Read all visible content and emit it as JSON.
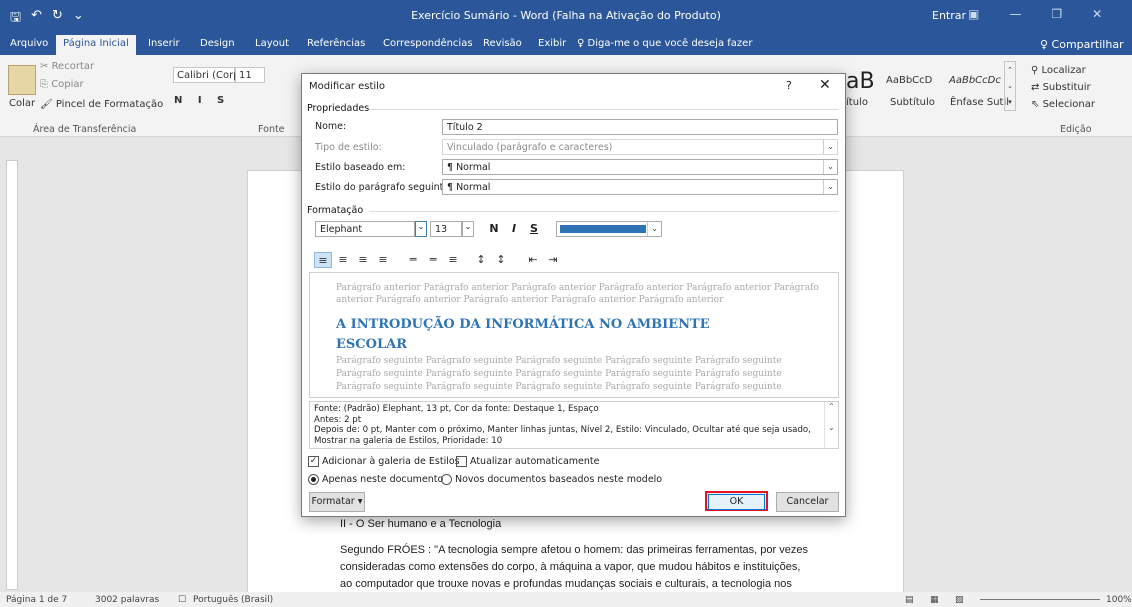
{
  "titlebar": {
    "title": "Exercício Sumário  -  Word (Falha na Ativação do Produto)",
    "entrar": "Entrar"
  },
  "tabs": [
    "Arquivo",
    "Página Inicial",
    "Inserir",
    "Design",
    "Layout",
    "Referências",
    "Correspondências",
    "Revisão",
    "Exibir"
  ],
  "tellme": "♀ Diga-me o que você deseja fazer",
  "share": "♀ Compartilhar",
  "ribbon": {
    "recortar": "Recortar",
    "copiar": "Copiar",
    "colar": "Colar",
    "pincel": "Pincel de Formatação",
    "font_name": "Calibri (Corp",
    "font_size": "11",
    "grp_clipboard": "Área de Transferência",
    "grp_font": "Fonte",
    "grp_edit": "Edição",
    "style_title": "ítulo",
    "style_subtitle": "Subtítulo",
    "style_emph": "Ênfase Sutil",
    "style_prev1": "AaBbCcD",
    "style_prev2": "AaBbCcDc",
    "style_big": "aB",
    "localizar": "Localizar",
    "substituir": "Substituir",
    "selecionar": "Selecionar"
  },
  "dialog": {
    "title": "Modificar estilo",
    "propriedades": "Propriedades",
    "nome_label": "Nome:",
    "nome_value": "Título 2",
    "tipo_label": "Tipo de estilo:",
    "tipo_value": "Vinculado (parágrafo e caracteres)",
    "base_label": "Estilo baseado em:",
    "base_value": "¶ Normal",
    "seg_label": "Estilo do parágrafo seguinte:",
    "seg_value": "¶ Normal",
    "formatacao": "Formatação",
    "font": "Elephant",
    "size": "13",
    "bold": "N",
    "italic": "I",
    "underline": "S",
    "font_color": "#2e74b5",
    "preview_prev1": "Parágrafo anterior Parágrafo anterior Parágrafo anterior Parágrafo anterior Parágrafo anterior Parágrafo",
    "preview_prev2": "anterior Parágrafo anterior Parágrafo anterior Parágrafo anterior Parágrafo anterior",
    "preview_head1": "A INTRODUÇÃO DA INFORMÁTICA NO AMBIENTE",
    "preview_head2": "ESCOLAR",
    "preview_next1": "Parágrafo seguinte Parágrafo seguinte Parágrafo seguinte Parágrafo seguinte Parágrafo seguinte",
    "preview_next2": "Parágrafo seguinte Parágrafo seguinte Parágrafo seguinte Parágrafo seguinte Parágrafo seguinte",
    "preview_next3": "Parágrafo seguinte Parágrafo seguinte Parágrafo seguinte Parágrafo seguinte Parágrafo seguinte",
    "desc1": "Fonte: (Padrão) Elephant, 13 pt, Cor da fonte: Destaque 1, Espaço",
    "desc2": "   Antes:  2 pt",
    "desc3": "   Depois de:  0 pt, Manter com o próximo, Manter linhas juntas, Nível 2, Estilo: Vinculado, Ocultar até que seja usado,",
    "desc4": "Mostrar na galeria de Estilos, Prioridade: 10",
    "add_gallery": "Adicionar à galeria de Estilos",
    "auto_update": "Atualizar automaticamente",
    "only_doc": "Apenas neste documento",
    "new_docs": "Novos documentos baseados neste modelo",
    "formatar": "Formatar ▾",
    "ok": "OK",
    "cancelar": "Cancelar"
  },
  "document": {
    "heading": "II - O Ser humano e a Tecnologia",
    "p1": "Segundo FRÓES : \"A tecnologia sempre afetou o homem: das primeiras ferramentas, por vezes",
    "p2": "consideradas como extensões do corpo, à máquina a vapor, que mudou hábitos e instituições,",
    "p3": "ao computador que trouxe novas e profundas mudanças sociais e culturais, a tecnologia nos"
  },
  "status": {
    "page": "Página 1 de 7",
    "words": "3002 palavras",
    "lang": "Português (Brasil)",
    "zoom": "100%"
  }
}
